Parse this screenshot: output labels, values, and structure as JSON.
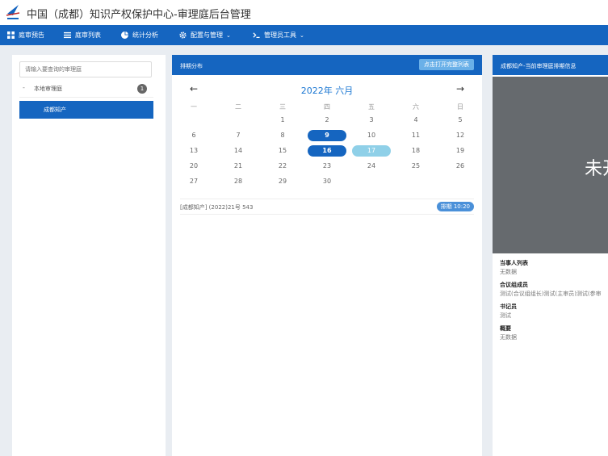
{
  "header": {
    "title": "中国（成都）知识产权保护中心-审理庭后台管理",
    "logo_icon": "logo-icon"
  },
  "nav": [
    {
      "label": "庭审预告",
      "icon": "grid-icon"
    },
    {
      "label": "庭审列表",
      "icon": "list-icon"
    },
    {
      "label": "统计分析",
      "icon": "pie-chart-icon"
    },
    {
      "label": "配置与管理",
      "icon": "gear-icon",
      "dropdown": true
    },
    {
      "label": "管理员工具",
      "icon": "terminal-icon",
      "dropdown": true
    }
  ],
  "nav_caret": "⌄",
  "left": {
    "search_placeholder": "请输入要查询的审理庭",
    "tree_toggle": "-",
    "tree_node": "本地审理庭",
    "tree_count": "1",
    "selected_item": "成都知产"
  },
  "calendar": {
    "panel_title": "排期分布",
    "button": "点击打开完整列表",
    "month_title": "2022年 六月",
    "prev": "←",
    "next": "→",
    "weekdays": [
      "一",
      "二",
      "三",
      "四",
      "五",
      "六",
      "日"
    ],
    "weeks": [
      [
        "",
        "",
        "1",
        "2",
        "3",
        "4",
        "5"
      ],
      [
        "6",
        "7",
        "8",
        "9",
        "10",
        "11",
        "12"
      ],
      [
        "13",
        "14",
        "15",
        "16",
        "17",
        "18",
        "19"
      ],
      [
        "20",
        "21",
        "22",
        "23",
        "24",
        "25",
        "26"
      ],
      [
        "27",
        "28",
        "29",
        "30",
        "",
        "",
        ""
      ]
    ],
    "scheduled_days": [
      "9",
      "16"
    ],
    "today": "17",
    "schedule": {
      "case": "[成都知产] (2022)21号 543",
      "badge": "排期 10:20"
    }
  },
  "right": {
    "panel_title": "成都知产-当前审理庭排期信息",
    "video_text": "未开",
    "fields": [
      {
        "label": "当事人列表",
        "value": "无数据"
      },
      {
        "label": "合议组成员",
        "value": "测试(合议组组长)测试(主审员)测试(参审"
      },
      {
        "label": "书记员",
        "value": "测试"
      },
      {
        "label": "概要",
        "value": "无数据"
      }
    ]
  },
  "colors": {
    "primary": "#1565c0",
    "today": "#8fd0e8",
    "video_bg": "#666a6e"
  }
}
